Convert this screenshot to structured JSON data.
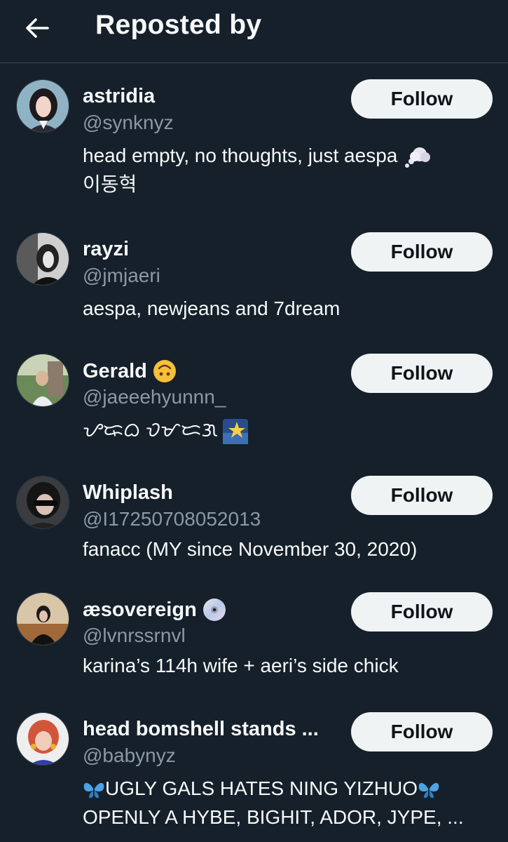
{
  "header": {
    "title": "Reposted by",
    "back_icon": "arrow-left-icon"
  },
  "users": [
    {
      "name": "astridia",
      "handle": "@synknyz",
      "bio_line1": "head empty, no thoughts, just aespa",
      "bio_line1_icon": "thought-bubble-icon",
      "bio_line2": "이동혁",
      "follow_label": "Follow"
    },
    {
      "name": "rayzi",
      "handle": "@jmjaeri",
      "bio_line1": "aespa, newjeans and 7dream",
      "follow_label": "Follow"
    },
    {
      "name": "Gerald",
      "name_icon": "upside-down-face-icon",
      "handle": "@jaeeehyunnn_",
      "bio_line1": "ᜌᜍᜊ ᜏᜋᜇᜄ",
      "bio_line1_icon": "star-night-icon",
      "follow_label": "Follow"
    },
    {
      "name": "Whiplash",
      "handle": "@I17250708052013",
      "bio_line1": "fanacc (MY since November 30, 2020)",
      "follow_label": "Follow"
    },
    {
      "name": "æsovereign",
      "name_icon": "disc-icon",
      "handle": "@lvnrssrnvl",
      "bio_line1": "karina’s 114h wife + aeri’s side chick",
      "follow_label": "Follow"
    },
    {
      "name": "head bomshell stands ...",
      "handle": "@babynyz",
      "bio_line1": "UGLY GALS HATES NING YIZHUO",
      "bio_line1_icon": "butterfly-icon",
      "bio_line2": "OPENLY A HYBE, BIGHIT, ADOR, JYPE, ...",
      "follow_label": "Follow"
    }
  ]
}
